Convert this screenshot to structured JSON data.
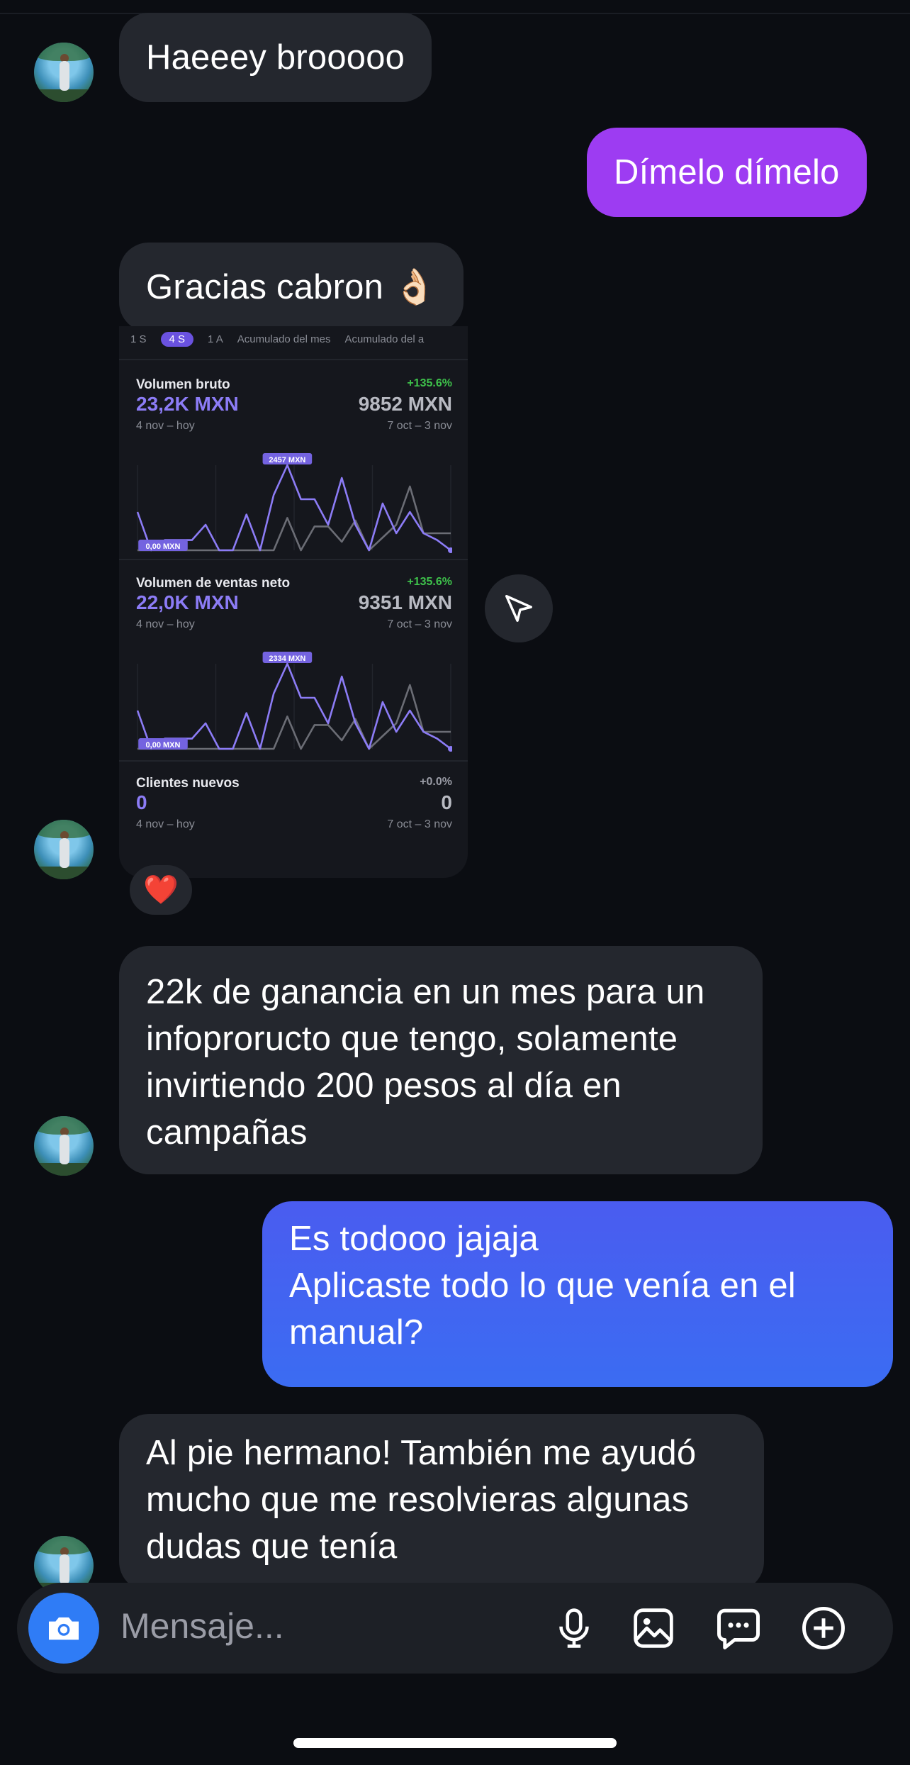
{
  "messages": {
    "m1": "Haeeey brooooo",
    "m2": "Dímelo dímelo",
    "m3": "Gracias cabron 👌🏻",
    "m4": "22k de ganancia en un mes para un infopror­ucto que tengo, solamente invirtiendo 200 pesos al día en campañas",
    "m5_line1": "Es todooo jajaja",
    "m5_line2": "Aplicaste todo lo que venía en el manual?",
    "m6": "Al pie hermano! También me ayudó mucho que me resolvieras algunas dudas que tenía"
  },
  "shared_card": {
    "tabs": [
      "1 S",
      "4 S",
      "1 A",
      "Acumulado del mes",
      "Acumulado del a"
    ],
    "sections": [
      {
        "label": "Volumen bruto",
        "pct": "+135.6%",
        "value": "23,2K MXN",
        "prev_value": "9852 MXN",
        "range": "4 nov – hoy",
        "prev_range": "7 oct – 3 nov",
        "peak_label": "2457 MXN",
        "min_label": "0,00 MXN"
      },
      {
        "label": "Volumen de ventas neto",
        "pct": "+135.6%",
        "value": "22,0K MXN",
        "prev_value": "9351 MXN",
        "range": "4 nov – hoy",
        "prev_range": "7 oct – 3 nov",
        "peak_label": "2334 MXN",
        "min_label": "0,00 MXN"
      },
      {
        "label": "Clientes nuevos",
        "pct": "+0.0%",
        "value": "0",
        "prev_value": "0",
        "range": "4 nov – hoy",
        "prev_range": "7 oct – 3 nov"
      }
    ],
    "series_current": [
      0.45,
      0.0,
      0.12,
      0.12,
      0.12,
      0.3,
      0.0,
      0.0,
      0.42,
      0.0,
      0.65,
      1.0,
      0.6,
      0.6,
      0.3,
      0.85,
      0.3,
      0.0,
      0.55,
      0.2,
      0.45,
      0.2,
      0.12,
      0.0
    ],
    "series_previous": [
      0.0,
      0.0,
      0.0,
      0.0,
      0.0,
      0.0,
      0.0,
      0.0,
      0.0,
      0.0,
      0.0,
      0.38,
      0.0,
      0.28,
      0.28,
      0.1,
      0.35,
      0.0,
      0.15,
      0.3,
      0.75,
      0.2,
      0.2,
      0.2
    ]
  },
  "reaction": "❤️",
  "composer": {
    "placeholder": "Mensaje..."
  },
  "icons": [
    "send-icon",
    "camera-icon",
    "microphone-icon",
    "image-icon",
    "sticker-icon",
    "plus-icon",
    "heart-icon"
  ],
  "colors": {
    "purple_bubble": "#9d3cf2",
    "blue_bubble": "#3b6cf2",
    "incoming_bubble": "#24272e",
    "camera_button": "#2f7cf6"
  }
}
